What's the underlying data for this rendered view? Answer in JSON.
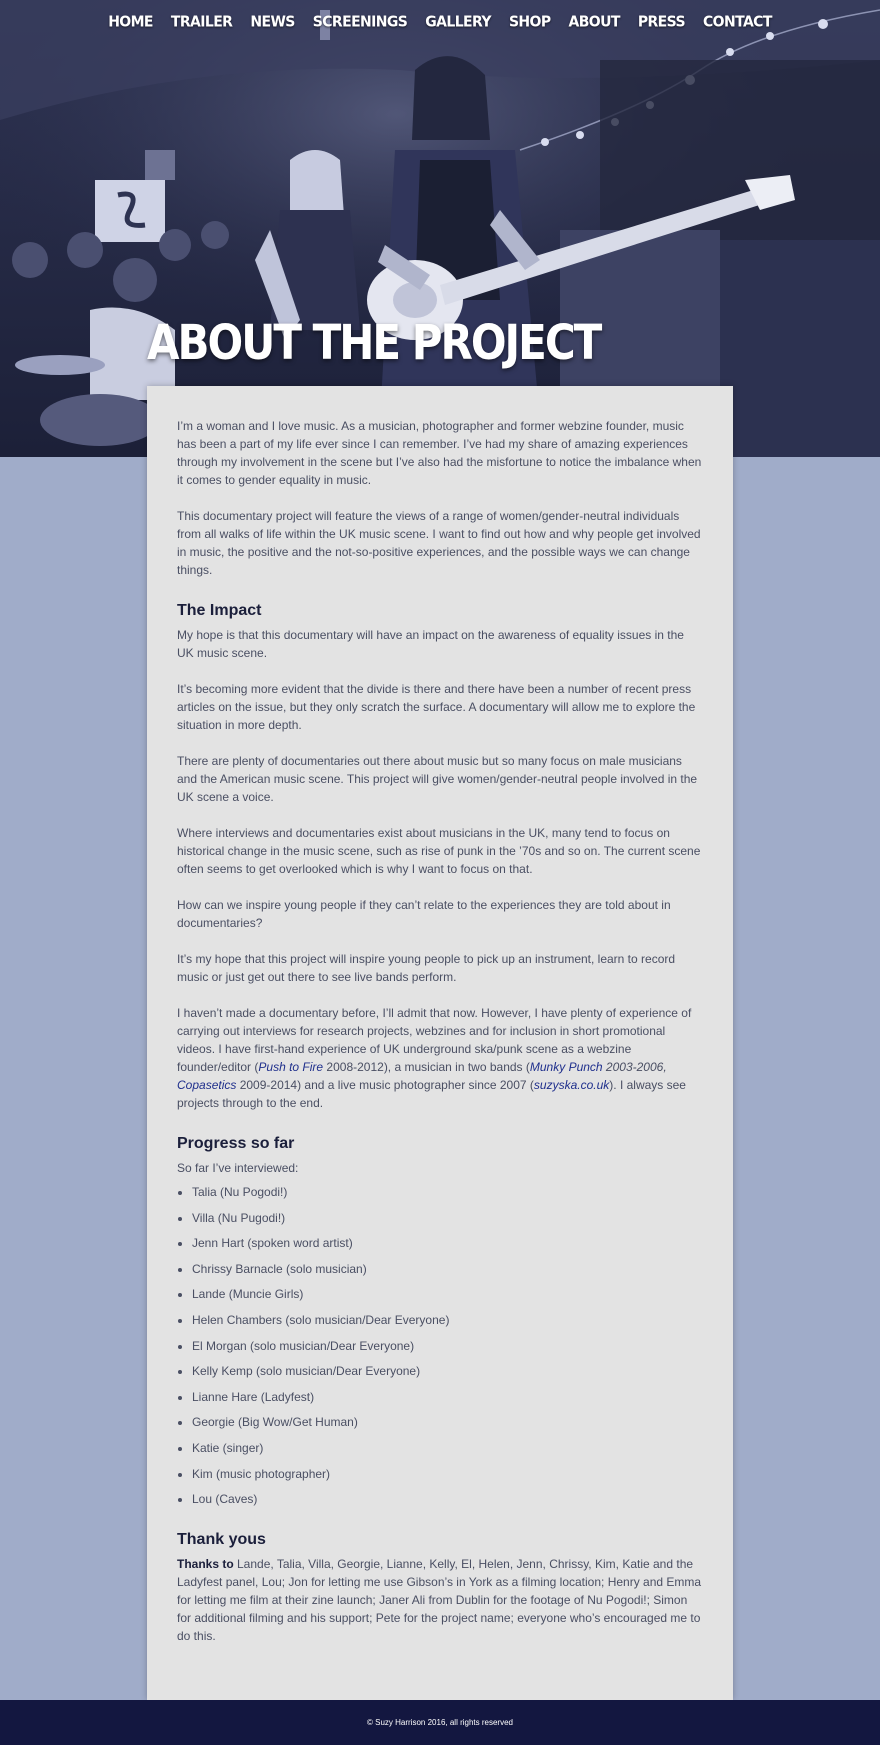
{
  "nav": {
    "items": [
      "HOME",
      "TRAILER",
      "NEWS",
      "SCREENINGS",
      "GALLERY",
      "SHOP",
      "ABOUT",
      "PRESS",
      "CONTACT"
    ]
  },
  "hero": {
    "title": "ABOUT THE PROJECT"
  },
  "intro": {
    "p1": "I’m a woman and I love music. As a musician, photographer and former webzine founder, music has been a part of my life ever since I can remember. I’ve had my share of amazing experiences through my involvement in the scene but I’ve also had the misfortune to notice the imbalance when it comes to gender equality in music.",
    "p2": "This documentary project will feature the views of a range of women/gender-neutral individuals from all walks of life within the UK music scene. I want to find out how and why people get involved in music, the positive and the not-so-positive experiences, and the possible ways we can change things."
  },
  "impact": {
    "heading": "The Impact",
    "p1": "My hope is that this documentary will have an impact on the awareness of equality issues in the UK music scene.",
    "p2": "It’s becoming more evident that the divide is there and there have been a number of recent press articles on the issue, but they only scratch the surface. A documentary will allow me to explore the situation in more depth.",
    "p3": "There are plenty of documentaries out there about music but so many focus on male musicians and the American music scene. This project will give women/gender-neutral people involved in the UK scene a voice.",
    "p4": "Where interviews and documentaries exist about musicians in the UK, many tend to focus on historical change in the music scene, such as rise of punk in the ’70s and so on. The current scene often seems to get overlooked which is why I want to focus on that.",
    "p5": "How can we inspire young people if they can’t relate to the experiences they are told about in documentaries?",
    "p6": "It’s my hope that this project will inspire young people to pick up an instrument, learn to record music or just get out there to see live bands perform.",
    "p7": {
      "t1": "I haven’t made a documentary before, I’ll admit that now. However, I have plenty of experience of carrying out interviews for research projects, webzines and for inclusion in short promotional videos. I have first-hand experience of UK underground ska/punk scene as a webzine founder/editor (",
      "link1": "Push to Fire",
      "t2": " 2008-2012), a musician in two bands (",
      "link2": "Munky Punch",
      "t3": " 2003-2006, ",
      "link3": "Copasetics",
      "t4": " 2009-2014) and a live music photographer since 2007 (",
      "link4": "suzyska.co.uk",
      "t5": "). I always see projects through to the end."
    }
  },
  "progress": {
    "heading": "Progress so far",
    "intro": "So far I’ve interviewed:",
    "items": [
      "Talia (Nu Pogodi!)",
      "Villa (Nu Pugodi!)",
      "Jenn Hart (spoken word artist)",
      "Chrissy Barnacle (solo musician)",
      "Lande (Muncie Girls)",
      "Helen Chambers (solo musician/Dear Everyone)",
      "El Morgan (solo musician/Dear Everyone)",
      "Kelly Kemp (solo musician/Dear Everyone)",
      "Lianne Hare (Ladyfest)",
      "Georgie (Big Wow/Get Human)",
      "Katie (singer)",
      "Kim (music photographer)",
      "Lou (Caves)"
    ]
  },
  "thanks": {
    "heading": "Thank yous",
    "bold": "Thanks to",
    "text": " Lande, Talia, Villa, Georgie, Lianne, Kelly, El, Helen, Jenn, Chrissy, Kim, Katie and the Ladyfest panel, Lou; Jon for letting me use Gibson’s in York as a filming location; Henry and Emma for letting me film at their zine launch; Janer Ali from Dublin for the footage of Nu Pogodi!; Simon for additional filming and his support; Pete for the project name; everyone who’s encouraged me to do this."
  },
  "footer": {
    "copyright": "© Suzy Harrison 2016, all rights reserved"
  },
  "colors": {
    "page_bg": "#a0acc9",
    "card_bg": "#e3e3e3",
    "hero_tint": "#262b47",
    "footer_bg": "#131740",
    "link": "#1f2f8c"
  }
}
